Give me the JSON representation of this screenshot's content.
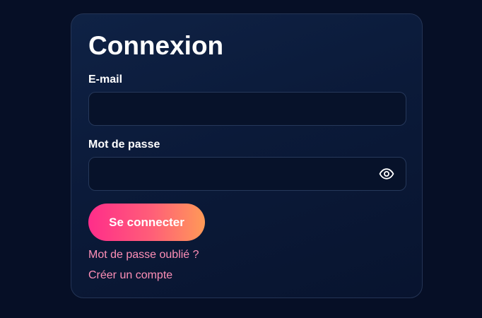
{
  "login": {
    "title": "Connexion",
    "email_label": "E-mail",
    "email_value": "",
    "password_label": "Mot de passe",
    "password_value": "",
    "submit_label": "Se connecter",
    "forgot_password_label": "Mot de passe oublié ?",
    "create_account_label": "Créer un compte",
    "show_password_icon": "eye-icon"
  },
  "colors": {
    "page_background": "#060f26",
    "card_background": "#0b1a39",
    "accent_gradient_start": "#ff2d8a",
    "accent_gradient_end": "#ff9a57",
    "link": "#ff8fb7"
  }
}
